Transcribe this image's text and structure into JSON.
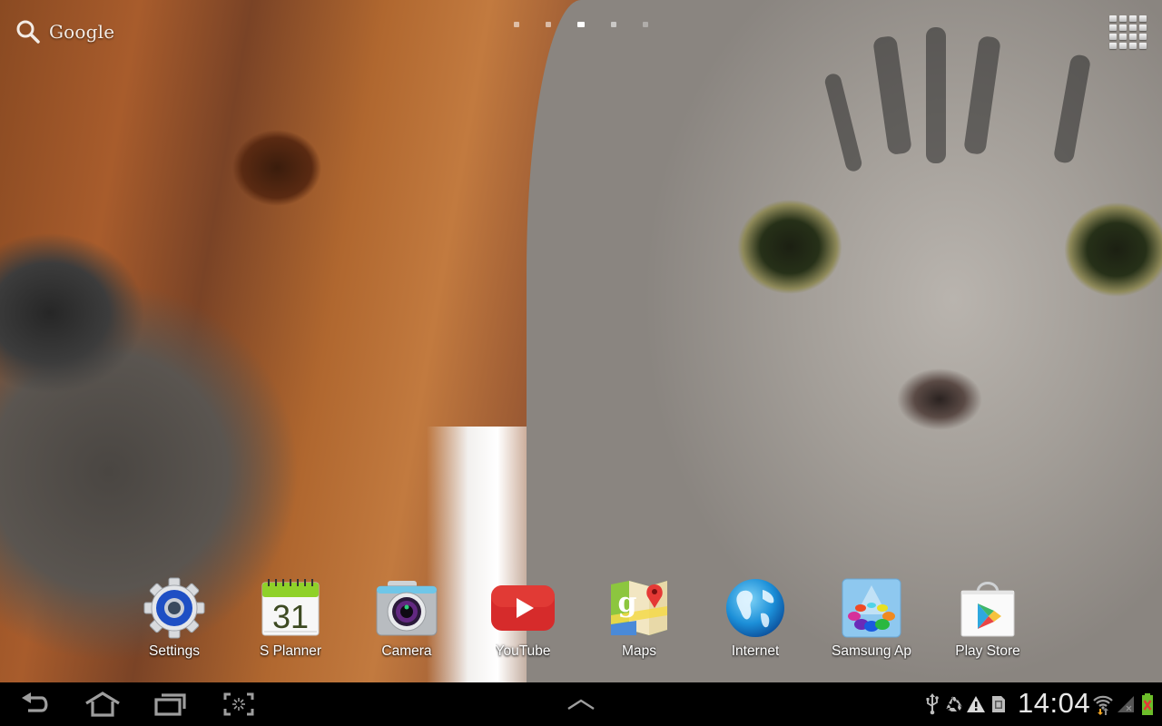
{
  "screen": {
    "type": "android-tablet-home-screen",
    "wallpaper": "dog-and-kitten-closeup"
  },
  "search_widget": {
    "icon": "search-icon",
    "label": "Google"
  },
  "page_indicator": {
    "total_pages": 5,
    "current_page": 3
  },
  "apps_button": {
    "icon": "apps-grid-icon"
  },
  "dock": {
    "apps": [
      {
        "label": "Settings",
        "icon": "settings-gear-icon"
      },
      {
        "label": "S Planner",
        "icon": "calendar-icon",
        "icon_text": "31"
      },
      {
        "label": "Camera",
        "icon": "camera-icon"
      },
      {
        "label": "YouTube",
        "icon": "youtube-play-icon"
      },
      {
        "label": "Maps",
        "icon": "maps-pin-icon"
      },
      {
        "label": "Internet",
        "icon": "globe-icon"
      },
      {
        "label": "Samsung Ap",
        "icon": "samsung-apps-icon"
      },
      {
        "label": "Play Store",
        "icon": "play-store-bag-icon"
      }
    ]
  },
  "navigation_bar": {
    "buttons": [
      {
        "name": "back",
        "icon": "back-arrow-icon"
      },
      {
        "name": "home",
        "icon": "home-icon"
      },
      {
        "name": "recent-apps",
        "icon": "recent-apps-icon"
      },
      {
        "name": "screenshot",
        "icon": "screen-capture-icon"
      },
      {
        "name": "mini-app-tray",
        "icon": "chevron-up-icon"
      }
    ]
  },
  "status_bar": {
    "time": "14:04",
    "notifications": [
      "usb-icon",
      "recycle-icon",
      "warning-icon",
      "sd-card-icon"
    ],
    "wifi": "wifi-icon",
    "signal": "no-signal-icon",
    "battery": "battery-charging-error-icon"
  },
  "colors": {
    "navbar_bg": "#000000",
    "nav_icon": "#9e9e9e",
    "clock_text": "#e8e8e8",
    "youtube_red": "#d62b2b",
    "planner_green": "#8fd129",
    "settings_blue": "#1e4fc4",
    "battery_green": "#6cbd2a",
    "battery_error": "#e53935",
    "wifi_arrow_orange": "#f5a623"
  }
}
